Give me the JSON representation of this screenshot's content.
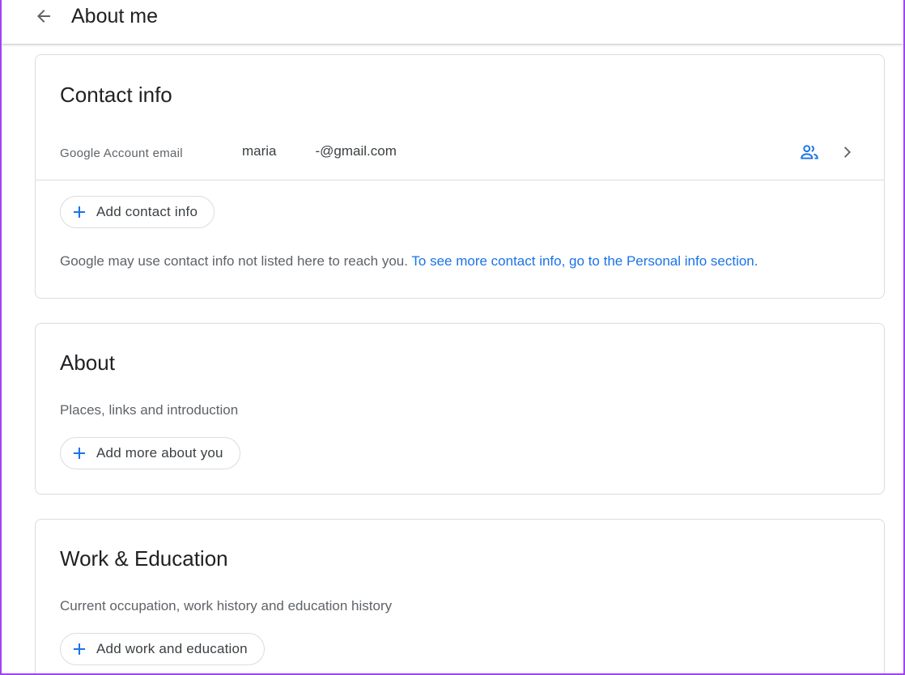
{
  "header": {
    "title": "About me",
    "back_icon": "arrow-back-icon"
  },
  "colors": {
    "accent": "#1a73e8",
    "text_primary": "#202124",
    "text_secondary": "#5f6368",
    "border": "#dadce0",
    "frame": "#a142f4"
  },
  "contact_info": {
    "title": "Contact info",
    "email_label": "Google Account email",
    "email_prefix": "maria",
    "email_suffix": "-@gmail.com",
    "people_icon": "people-icon",
    "chevron_icon": "chevron-right-icon",
    "add_button": "Add contact info",
    "note_text": "Google may use contact info not listed here to reach you.",
    "note_link": "To see more contact info, go to the Personal info section."
  },
  "about": {
    "title": "About",
    "subtitle": "Places, links and introduction",
    "add_button": "Add more about you"
  },
  "work_education": {
    "title": "Work & Education",
    "subtitle": "Current occupation, work history and education history",
    "add_button": "Add work and education"
  }
}
